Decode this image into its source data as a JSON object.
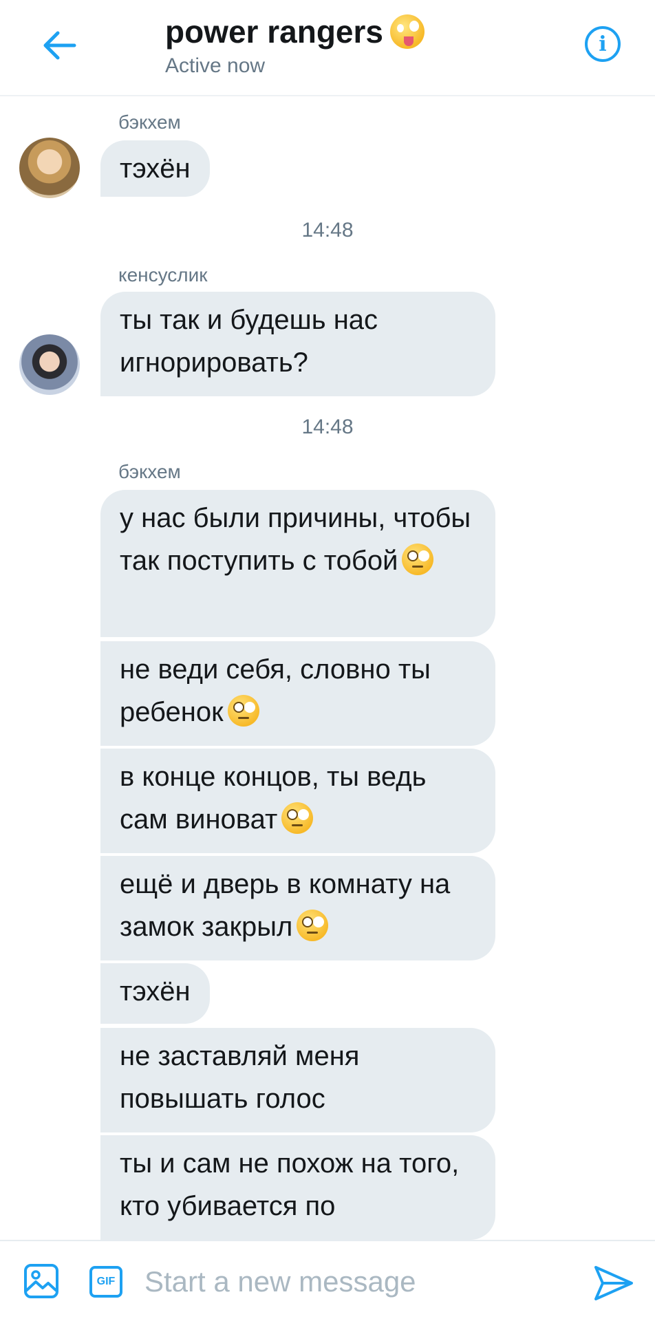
{
  "header": {
    "title": "power rangers",
    "title_emoji": "zany-face-emoji",
    "status": "Active now",
    "back_icon": "arrow-left-icon",
    "info_icon": "info-icon"
  },
  "messages": [
    {
      "sender": "бэкхем",
      "text": "тэхён"
    },
    {
      "timestamp": "14:48"
    },
    {
      "sender": "кенсуслик",
      "text": "ты так и будешь нас игнорировать?"
    },
    {
      "timestamp": "14:48"
    },
    {
      "sender": "бэкхем"
    },
    {
      "text": "у нас были причины, чтобы так поступить с тобой"
    },
    {
      "text": "не веди себя, словно ты ребенок"
    },
    {
      "text": "в конце концов, ты ведь сам виноват"
    },
    {
      "text": "ещё и дверь в комнату на замок закрыл"
    },
    {
      "text": "тэхён"
    },
    {
      "text": "не заставляй меня повышать голос"
    },
    {
      "text": "ты и сам не похож на того, кто убивается по"
    }
  ],
  "emoji": "face-with-rolling-eyes-emoji",
  "composer": {
    "placeholder": "Start a new message",
    "media_icon": "image-icon",
    "gif_label": "GIF",
    "send_icon": "send-icon"
  },
  "colors": {
    "accent": "#1da1f2",
    "bubble": "#e6ecf0",
    "muted": "#657786"
  }
}
